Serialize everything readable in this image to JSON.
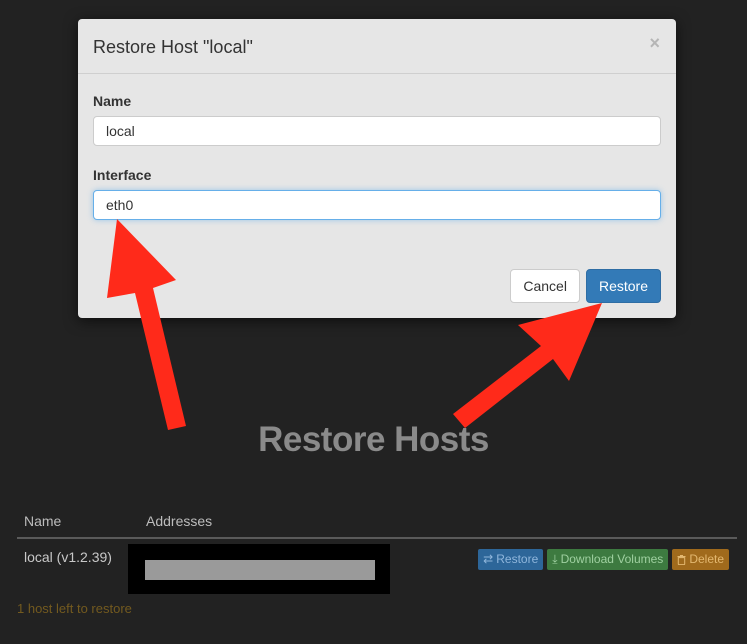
{
  "page": {
    "heading": "Restore Hosts",
    "table": {
      "columns": [
        "Name",
        "Addresses"
      ],
      "rows": [
        {
          "name": "local (v1.2.39)"
        }
      ]
    },
    "row_actions": {
      "restore_label": "Restore",
      "restore_icon": "exchange-icon",
      "download_label": "Download Volumes",
      "download_icon": "download-icon",
      "delete_label": "Delete",
      "delete_icon": "trash-icon"
    },
    "hosts_left": "1 host left to restore"
  },
  "modal": {
    "title": "Restore Host \"local\"",
    "close_symbol": "×",
    "name_label": "Name",
    "name_value": "local",
    "interface_label": "Interface",
    "interface_value": "eth0",
    "cancel_label": "Cancel",
    "restore_label": "Restore"
  },
  "colors": {
    "page_background": "#222222",
    "primary": "#337ab7",
    "annotation_arrow": "#ff2a1a"
  }
}
